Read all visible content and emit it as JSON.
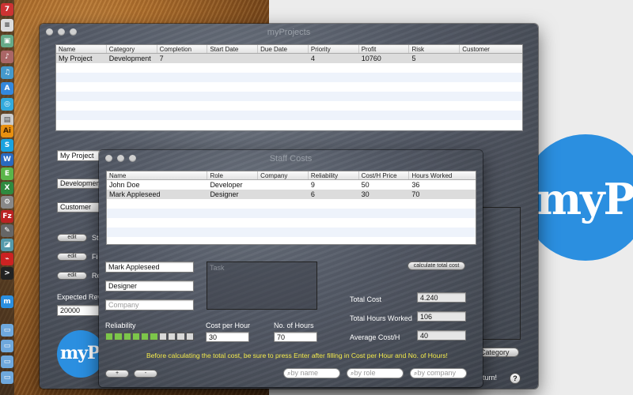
{
  "main_window": {
    "title": "myProjects",
    "columns": [
      "Name",
      "Category",
      "Completion",
      "Start Date",
      "Due Date",
      "Priority",
      "Profit",
      "Risk",
      "Customer"
    ],
    "rows": [
      [
        "My Project",
        "Development",
        "7",
        "",
        "",
        "4",
        "10760",
        "5",
        ""
      ]
    ],
    "project_name_value": "My Project",
    "category_value": "Development",
    "customer_value": "Customer",
    "edit_label": "edit",
    "side_labels": [
      "St",
      "Fi",
      "Re"
    ],
    "expected_rev_label": "Expected Rev",
    "expected_rev_value": "20000",
    "category_button": "Category",
    "return_text": "turn!",
    "help": "?",
    "logo_text": "myP"
  },
  "staff_window": {
    "title": "Staff Costs",
    "columns": [
      "Name",
      "Role",
      "Company",
      "Reliability",
      "Cost/H Price",
      "Hours Worked"
    ],
    "rows": [
      [
        "John Doe",
        "Developer",
        "",
        "9",
        "50",
        "36"
      ],
      [
        "Mark Appleseed",
        "Designer",
        "",
        "6",
        "30",
        "70"
      ]
    ],
    "name_value": "Mark Appleseed",
    "role_value": "Designer",
    "company_placeholder": "Company",
    "task_placeholder": "Task",
    "calculate_button": "calculate total cost",
    "total_cost_label": "Total Cost",
    "total_cost_value": "4.240",
    "total_hours_label": "Total Hours Worked",
    "total_hours_value": "106",
    "avg_cost_label": "Average Cost/H",
    "avg_cost_value": "40",
    "reliability_label": "Reliability",
    "reliability_level": 6,
    "reliability_max": 10,
    "cost_per_hour_label": "Cost per Hour",
    "cost_per_hour_value": "30",
    "hours_label": "No. of Hours",
    "hours_value": "70",
    "hint": "Before calculating the total cost, be sure to press Enter after filling in Cost per Hour and No. of Hours!",
    "add_button": "+",
    "remove_button": "-",
    "search_name": "by name",
    "search_role": "by role",
    "search_company": "by company"
  },
  "desktop": {
    "logo_text": "myP"
  },
  "colors": {
    "accent_blue": "#2b8fe0",
    "hint_yellow": "#f2e94a",
    "reliability_green": "#7cc64a"
  }
}
